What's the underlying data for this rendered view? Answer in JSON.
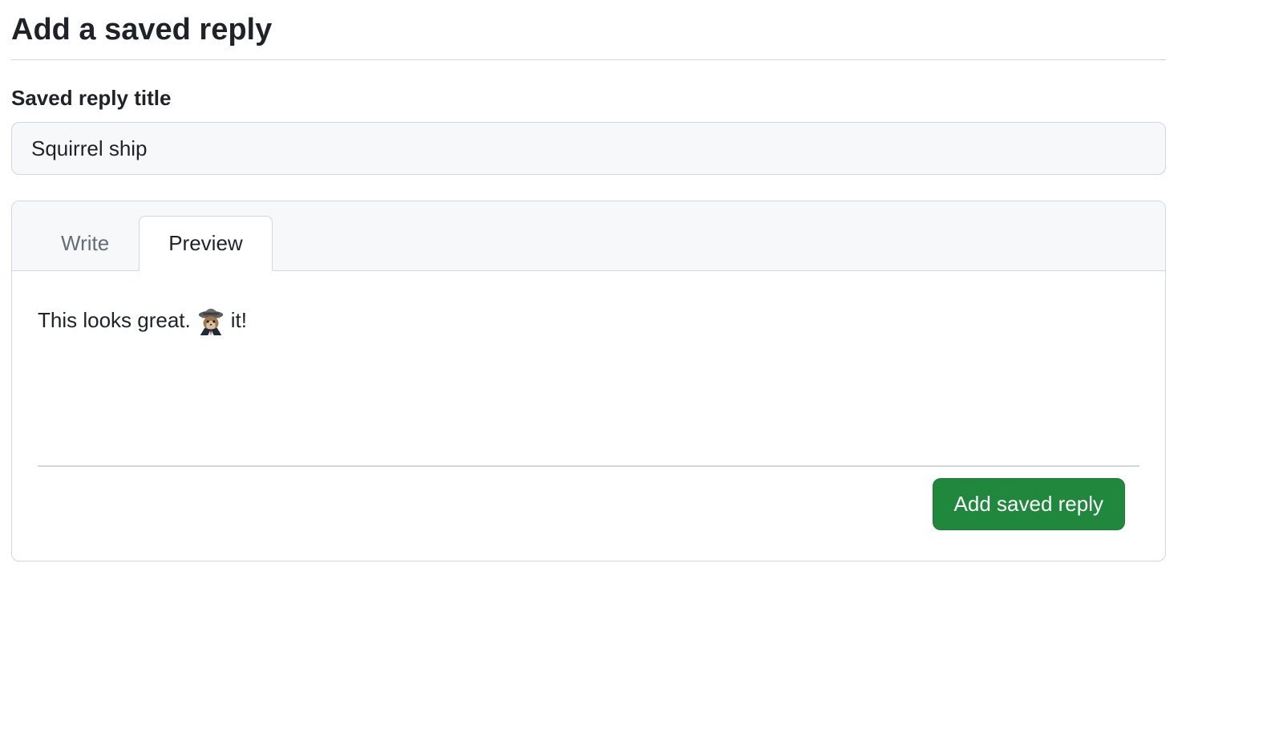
{
  "header": {
    "title": "Add a saved reply"
  },
  "form": {
    "title_label": "Saved reply title",
    "title_value": "Squirrel ship"
  },
  "editor": {
    "tabs": {
      "write": "Write",
      "preview": "Preview",
      "active": "preview"
    },
    "preview": {
      "before": "This looks great.",
      "after": "it!",
      "emoji_name": "shipit-squirrel"
    }
  },
  "actions": {
    "submit_label": "Add saved reply"
  }
}
